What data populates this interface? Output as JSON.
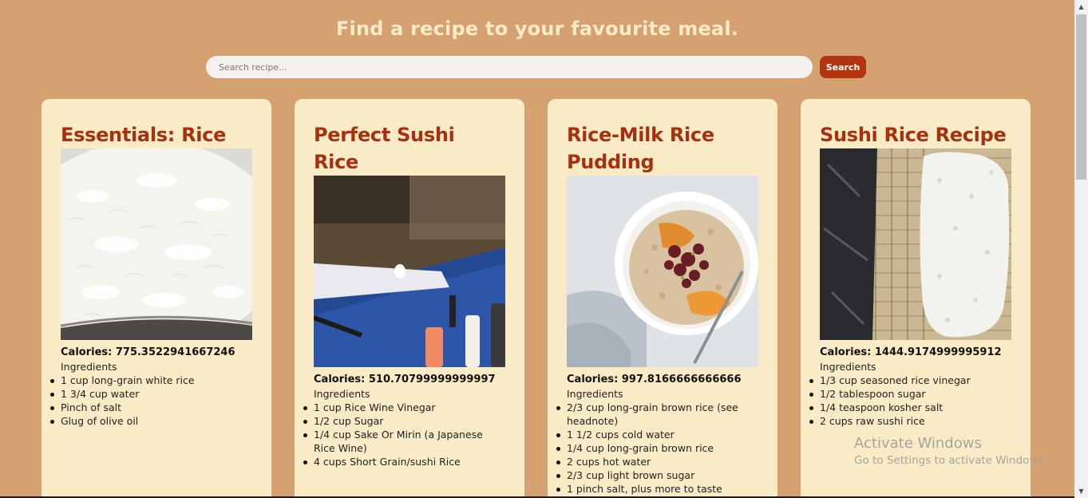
{
  "header": {
    "title": "Find a recipe to your favourite meal."
  },
  "search": {
    "placeholder": "Search recipe...",
    "value": "",
    "button_label": "Search"
  },
  "recipes": [
    {
      "title": "Essentials: Rice",
      "image": "bowl of cooked white rice",
      "calories": "Calories: 775.3522941667246",
      "ingredients_label": "Ingredients",
      "ingredients": [
        "1 cup long-grain white rice",
        "1 3/4 cup water",
        "Pinch of salt",
        "Glug of olive oil"
      ]
    },
    {
      "title": "Perfect Sushi Rice",
      "image": "gloved hand holding sushi rice ball",
      "calories": "Calories: 510.70799999999997",
      "ingredients_label": "Ingredients",
      "ingredients": [
        "1 cup Rice Wine Vinegar",
        "1/2 cup Sugar",
        "1/4 cup Sake Or Mirin (a Japanese Rice Wine)",
        "4 cups Short Grain/sushi Rice"
      ]
    },
    {
      "title": "Rice-Milk Rice Pudding",
      "image": "rice pudding bowl with orange and cherries",
      "calories": "Calories: 997.8166666666666",
      "ingredients_label": "Ingredients",
      "ingredients": [
        "2/3 cup long-grain brown rice (see headnote)",
        "1 1/2 cups cold water",
        "1/4 cup long-grain brown rice",
        "2 cups hot water",
        "2/3 cup light brown sugar",
        "1 pinch salt, plus more to taste"
      ]
    },
    {
      "title": "Sushi Rice Recipe",
      "image": "sushi rice spread on bamboo mat",
      "calories": "Calories: 1444.9174999995912",
      "ingredients_label": "Ingredients",
      "ingredients": [
        "1/3 cup seasoned rice vinegar",
        "1/2 tablespoon sugar",
        "1/4 teaspoon kosher salt",
        "2 cups raw sushi rice"
      ]
    }
  ],
  "watermark": {
    "title": "Activate Windows",
    "subtitle": "Go to Settings to activate Windows."
  },
  "colors": {
    "background": "#d5a171",
    "card": "#faebc7",
    "title_accent": "#a8300e",
    "button": "#b23511",
    "heading": "#faebc7"
  },
  "icons": [
    "scroll-up-arrow-icon",
    "scroll-down-arrow-icon"
  ]
}
